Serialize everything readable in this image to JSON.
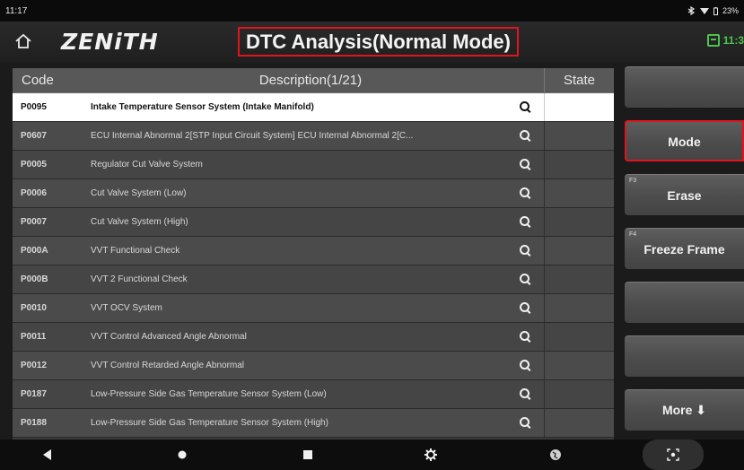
{
  "status_bar": {
    "time": "11:17",
    "battery": "23%"
  },
  "header": {
    "logo": "ZENiTH",
    "title": "DTC Analysis(Normal Mode)",
    "clock": "11:3"
  },
  "table": {
    "headers": {
      "code": "Code",
      "description": "Description(1/21)",
      "state": "State"
    },
    "rows": [
      {
        "code": "P0095",
        "description": "Intake Temperature Sensor System (Intake Manifold)",
        "state": ""
      },
      {
        "code": "P0607",
        "description": "ECU Internal Abnormal 2[STP Input Circuit System] ECU Internal Abnormal 2[C...",
        "state": ""
      },
      {
        "code": "P0005",
        "description": "Regulator Cut Valve System",
        "state": ""
      },
      {
        "code": "P0006",
        "description": "Cut Valve System (Low)",
        "state": ""
      },
      {
        "code": "P0007",
        "description": "Cut Valve System (High)",
        "state": ""
      },
      {
        "code": "P000A",
        "description": "VVT Functional Check",
        "state": ""
      },
      {
        "code": "P000B",
        "description": "VVT 2 Functional Check",
        "state": ""
      },
      {
        "code": "P0010",
        "description": "VVT OCV System",
        "state": ""
      },
      {
        "code": "P0011",
        "description": "VVT Control Advanced Angle Abnormal",
        "state": ""
      },
      {
        "code": "P0012",
        "description": "VVT Control Retarded Angle Abnormal",
        "state": ""
      },
      {
        "code": "P0187",
        "description": "Low-Pressure Side Gas Temperature Sensor System (Low)",
        "state": ""
      },
      {
        "code": "P0188",
        "description": "Low-Pressure Side Gas Temperature Sensor System (High)",
        "state": ""
      }
    ]
  },
  "side_buttons": {
    "mode": "Mode",
    "erase": "Erase",
    "erase_fkey": "F3",
    "freeze_frame": "Freeze Frame",
    "freeze_fkey": "F4",
    "more": "More ⬇"
  },
  "colors": {
    "highlight_red": "#e0141e",
    "accent_green": "#4ec34e"
  }
}
